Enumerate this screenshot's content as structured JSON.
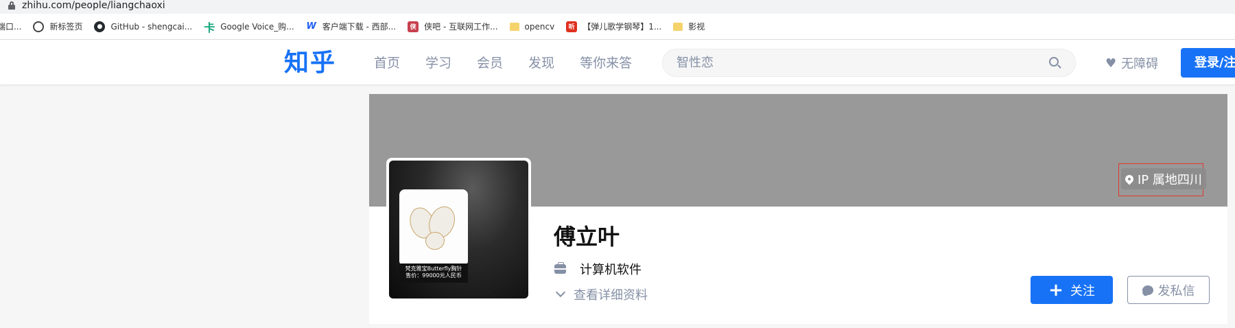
{
  "browser": {
    "url": "zhihu.com/people/liangchaoxi"
  },
  "bookmarks": [
    {
      "label": "端口...",
      "icon": "none"
    },
    {
      "label": "新标签页",
      "icon": "globe-icon"
    },
    {
      "label": "GitHub - shengcai...",
      "icon": "github-icon"
    },
    {
      "label": "Google Voice_购...",
      "icon": "ka-icon"
    },
    {
      "label": "客户端下载 - 西部...",
      "icon": "w-icon"
    },
    {
      "label": "侠吧 - 互联网工作...",
      "icon": "xia-icon"
    },
    {
      "label": "opencv",
      "icon": "folder-icon"
    },
    {
      "label": "【弹儿歌学钢琴】1...",
      "icon": "ting-icon"
    },
    {
      "label": "影视",
      "icon": "folder-icon"
    }
  ],
  "header": {
    "logo": "知乎",
    "nav": [
      "首页",
      "学习",
      "会员",
      "发现",
      "等你来答"
    ],
    "search_placeholder": "智性恋",
    "accessibility": "无障碍",
    "login": "登录/注册"
  },
  "profile": {
    "ip_location": "IP 属地四川",
    "name": "傅立叶",
    "industry": "计算机软件",
    "details_link": "查看详细资料",
    "follow": "关注",
    "message": "发私信",
    "avatar_caption_line1": "梵克雅宝Butterfly胸针",
    "avatar_caption_line2": "售价：99000元人民币"
  },
  "colors": {
    "brand": "#1772f6",
    "cover": "#999999",
    "highlight_box": "#e0392f",
    "muted_text": "#8590a6"
  }
}
